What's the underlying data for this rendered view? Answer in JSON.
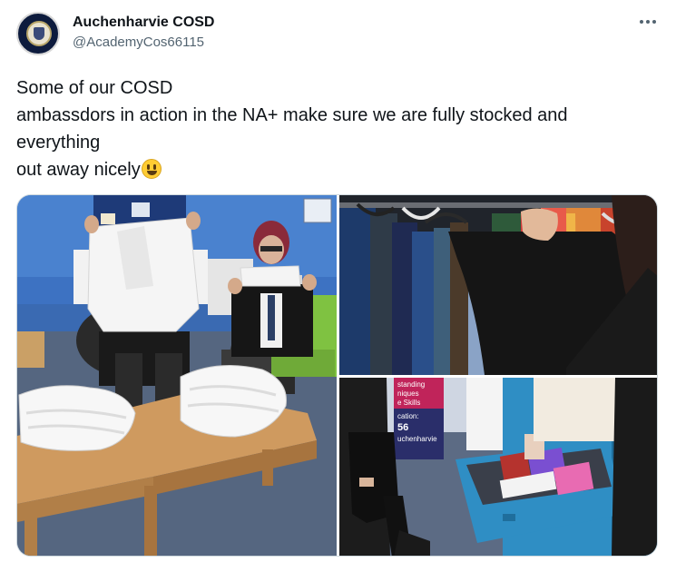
{
  "author": {
    "display_name": "Auchenharvie COSD",
    "handle": "@AcademyCos66115",
    "avatar_icon": "school-crest-icon"
  },
  "more_icon": "more-options-icon",
  "tweet": {
    "lines": [
      "Some of our COSD",
      "ambassdors in action in the NA+ make sure we are fully stocked and",
      "everything",
      "out away nicely"
    ],
    "emoji": "grinning-face-icon"
  },
  "photos": {
    "p2_sign": "",
    "p3_banner_lines": [
      "standing",
      "niques",
      "e Skills",
      "cation:",
      "56",
      "uchenharvie"
    ]
  },
  "colors": {
    "text": "#0f1419",
    "secondary": "#536471",
    "border": "#cfd9de"
  }
}
